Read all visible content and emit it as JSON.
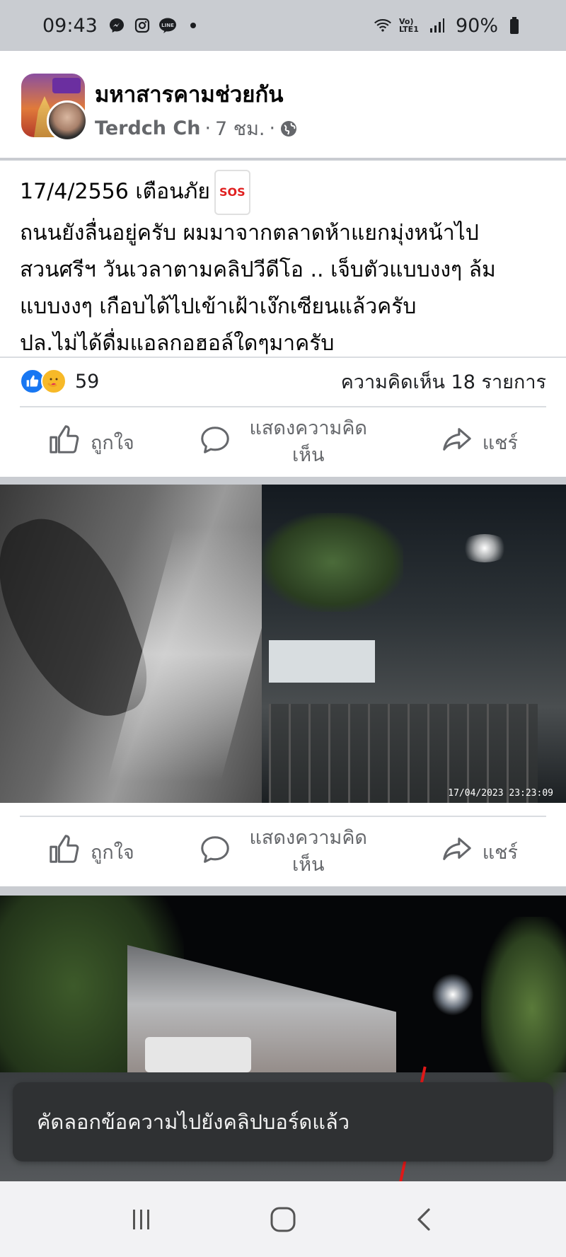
{
  "status_bar": {
    "time": "09:43",
    "battery": "90%",
    "network": "Vo) LTE1"
  },
  "post": {
    "group_name": "มหาสารคามช่วยกัน",
    "author": "Terdch Ch",
    "time_ago": "7 ชม.",
    "separator": "·",
    "text_line_1": "17/4/2556 เตือนภัย",
    "sos_badge": "SOS",
    "text_line_2": "ถนนยังลื่นอยู่ครับ ผมมาจากตลาดห้าแยกมุ่งหน้าไป",
    "text_line_3": "สวนศรีฯ วันเวลาตามคลิปวีดีโอ .. เจ็บตัวแบบงงๆ ล้ม",
    "text_line_4": "แบบงงๆ เกือบได้ไปเข้าเฝ้าเง๊กเซียนแล้วครับ",
    "text_line_5": "ปล.ไม่ได้ดื่มแอลกอฮอล์ใดๆมาครับ",
    "reaction_count": "59",
    "comment_count": "ความคิดเห็น 18 รายการ"
  },
  "actions": {
    "like": "ถูกใจ",
    "comment_line_1": "แสดงความคิด",
    "comment_line_2": "เห็น",
    "share": "แชร์"
  },
  "photo_1": {
    "timestamp": "17/04/2023    23:23:09"
  },
  "toast": {
    "message": "คัดลอกข้อความไปยังคลิปบอร์ดแล้ว"
  },
  "icons": {
    "messenger": "messenger-icon",
    "instagram": "instagram-icon",
    "line": "line-icon",
    "wifi": "wifi-icon",
    "signal": "signal-icon",
    "battery": "battery-icon",
    "globe": "globe-icon",
    "like": "thumbs-up-icon",
    "comment": "comment-icon",
    "share": "share-icon"
  },
  "colors": {
    "facebook_blue": "#1877f2",
    "care_yellow": "#f7b928",
    "sos_red": "#e02020",
    "secondary_text": "#65676b"
  }
}
